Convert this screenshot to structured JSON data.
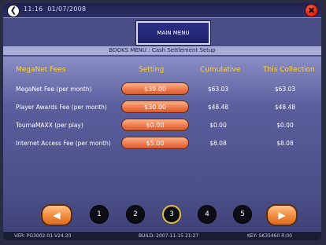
{
  "topbar": {
    "time": "11:16",
    "date": "01/07/2008"
  },
  "main_menu_label": "MAIN MENU",
  "subtitle": "BOOKS MENU : Cash Settlement Setup",
  "table": {
    "headers": {
      "fee": "MegaNet Fees",
      "setting": "Setting",
      "cumulative": "Cumulative",
      "collection": "This Collection"
    },
    "rows": [
      {
        "label": "MegaNet Fee (per month)",
        "setting": "$39.00",
        "cumulative": "$63.03",
        "collection": "$63.03"
      },
      {
        "label": "Player Awards Fee (per month)",
        "setting": "$30.00",
        "cumulative": "$48.48",
        "collection": "$48.48"
      },
      {
        "label": "TournaMAXX (per play)",
        "setting": "$0.00",
        "cumulative": "$0.00",
        "collection": "$0.00"
      },
      {
        "label": "Internet Access Fee (per month)",
        "setting": "$5.00",
        "cumulative": "$8.08",
        "collection": "$8.08"
      }
    ]
  },
  "pagination": {
    "pages": [
      "1",
      "2",
      "3",
      "4",
      "5"
    ],
    "active_page": "3"
  },
  "footer": {
    "version": "VER: PG3002-01 V24.20",
    "build": "BUILD: 2007-11-15 21:27",
    "key": "KEY: SK35460 R:00"
  },
  "colors": {
    "accent_gold": "#ffd23a",
    "pill_orange": "#ee7a4e",
    "screen_bg": "#4a4e86",
    "close_red": "#d81e12"
  }
}
